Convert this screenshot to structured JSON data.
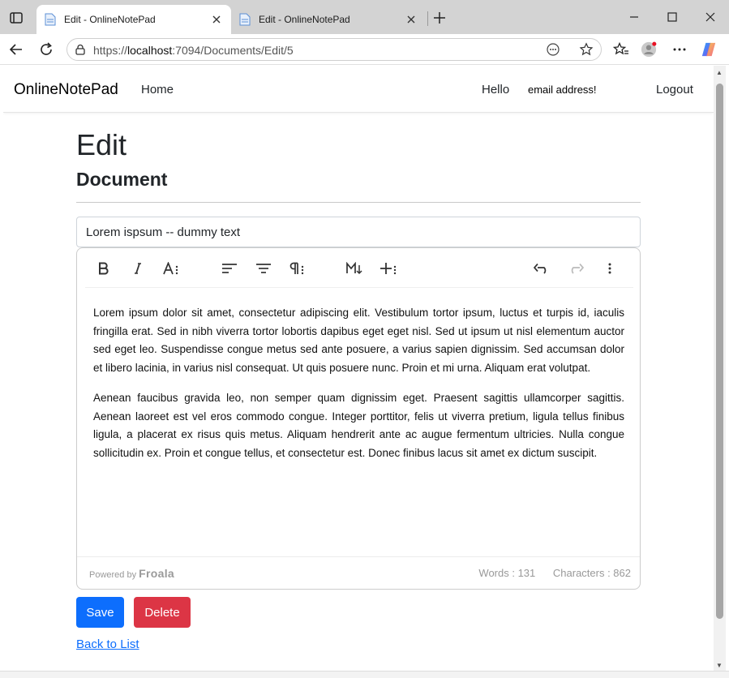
{
  "browser": {
    "tabs": [
      {
        "title": "Edit - OnlineNotePad",
        "active": true
      },
      {
        "title": "Edit - OnlineNotePad",
        "active": false
      }
    ],
    "url_prefix": "https://",
    "url_host": "localhost",
    "url_rest": ":7094/Documents/Edit/5"
  },
  "nav": {
    "brand": "OnlineNotePad",
    "home": "Home",
    "hello": "Hello",
    "email": "email address!",
    "logout": "Logout"
  },
  "page": {
    "heading": "Edit",
    "subheading": "Document",
    "title_value": "Lorem ispsum -- dummy text"
  },
  "editor": {
    "paragraphs": [
      "Lorem ipsum dolor sit amet, consectetur adipiscing elit. Vestibulum tortor ipsum, luctus et turpis id, iaculis fringilla erat. Sed in nibh viverra tortor lobortis dapibus eget eget nisl. Sed ut ipsum ut nisl elementum auctor sed eget leo. Suspendisse congue metus sed ante posuere, a varius sapien dignissim. Sed accumsan dolor et libero lacinia, in varius nisl consequat. Ut quis posuere nunc. Proin et mi urna. Aliquam erat volutpat.",
      "Aenean faucibus gravida leo, non semper quam dignissim eget. Praesent sagittis ullamcorper sagittis. Aenean laoreet est vel eros commodo congue. Integer porttitor, felis ut viverra pretium, ligula tellus finibus ligula, a placerat ex risus quis metus. Aliquam hendrerit ante ac augue fermentum ultricies. Nulla congue sollicitudin ex. Proin et congue tellus, et consectetur est. Donec finibus lacus sit amet ex dictum suscipit."
    ],
    "powered_by": "Powered by",
    "powered_brand": "Froala",
    "words": "Words : 131",
    "characters": "Characters : 862",
    "toolbar_icons": [
      "bold-icon",
      "italic-icon",
      "text-format-icon",
      "align-left-icon",
      "align-center-icon",
      "paragraph-format-icon",
      "markdown-icon",
      "insert-more-icon",
      "undo-icon",
      "redo-icon",
      "more-options-icon"
    ]
  },
  "actions": {
    "save": "Save",
    "delete": "Delete",
    "back": "Back to List"
  },
  "colors": {
    "primary": "#0d6efd",
    "danger": "#dc3545"
  }
}
